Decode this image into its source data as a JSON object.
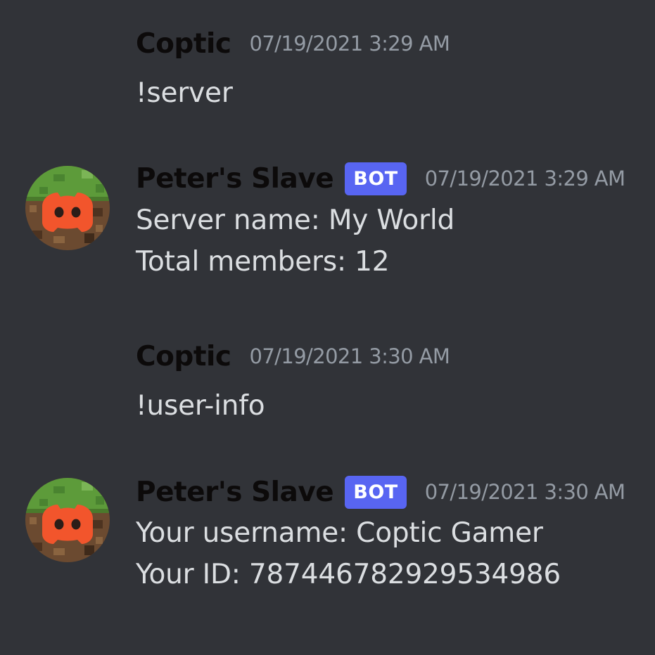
{
  "messages": [
    {
      "author": "Coptic",
      "timestamp": "07/19/2021 3:29 AM",
      "lines": [
        "!server"
      ]
    },
    {
      "author": "Peter's Slave",
      "badge": "BOT",
      "timestamp": "07/19/2021 3:29 AM",
      "avatar_icon": "discord-logo-on-grass-block",
      "lines": [
        "Server name: My World",
        "Total members: 12"
      ]
    },
    {
      "author": "Coptic",
      "timestamp": "07/19/2021 3:30 AM",
      "lines": [
        "!user-info"
      ]
    },
    {
      "author": "Peter's Slave",
      "badge": "BOT",
      "timestamp": "07/19/2021 3:30 AM",
      "avatar_icon": "discord-logo-on-grass-block",
      "lines": [
        "Your username: Coptic Gamer",
        "Your ID: 787446782929534986"
      ]
    }
  ],
  "colors": {
    "background": "#313338",
    "username": "#0c0a0a",
    "bot_badge": "#5865f2",
    "timestamp": "#949ba4",
    "message_text": "#dbdee1",
    "avatar_logo": "#f2552c"
  }
}
